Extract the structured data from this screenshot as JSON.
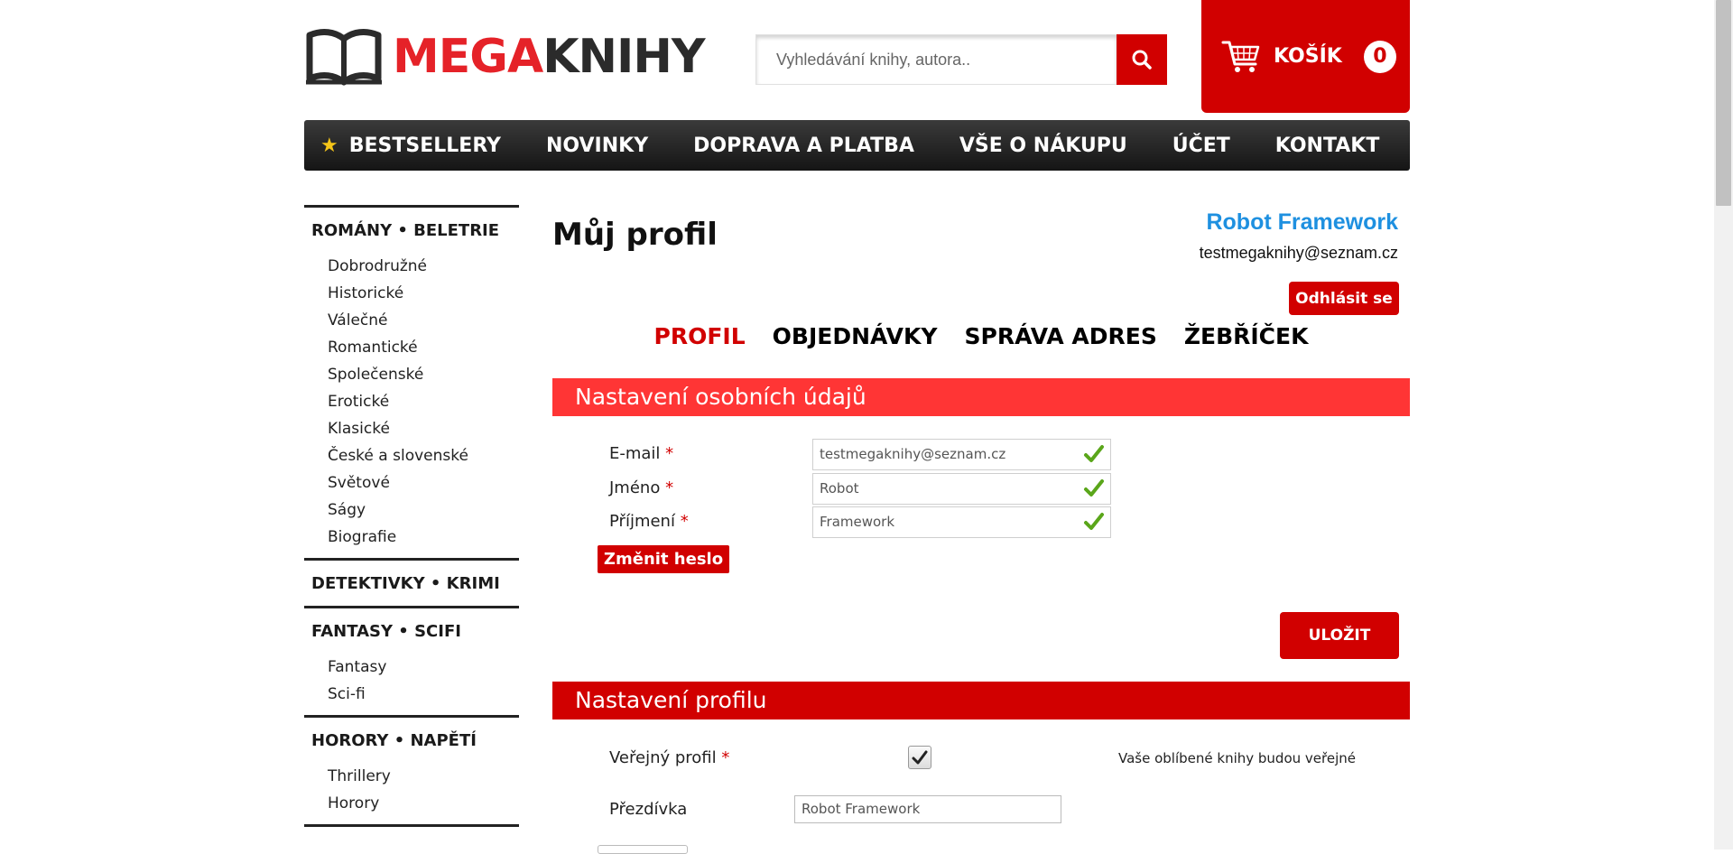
{
  "header": {
    "logo_text_mega": "MEGA",
    "logo_text_knihy": "KNIHY",
    "search_placeholder": "Vyhledávání knihy, autora..",
    "cart_label": "KOŠÍK",
    "cart_count": "0"
  },
  "nav": {
    "items": [
      "BESTSELLERY",
      "NOVINKY",
      "DOPRAVA A PLATBA",
      "VŠE O NÁKUPU",
      "ÚČET",
      "KONTAKT"
    ]
  },
  "sidebar": {
    "categories": [
      {
        "title": "ROMÁNY • BELETRIE",
        "items": [
          "Dobrodružné",
          "Historické",
          "Válečné",
          "Romantické",
          "Společenské",
          "Erotické",
          "Klasické",
          "České a slovenské",
          "Světové",
          "Ságy",
          "Biografie"
        ]
      },
      {
        "title": "DETEKTIVKY • KRIMI",
        "items": []
      },
      {
        "title": "FANTASY • SCIFI",
        "items": [
          "Fantasy",
          "Sci-fi"
        ]
      },
      {
        "title": "HORORY • NAPĚTÍ",
        "items": [
          "Thrillery",
          "Horory"
        ]
      }
    ]
  },
  "profile": {
    "page_title": "Můj profil",
    "user_name": "Robot Framework",
    "user_email": "testmegaknihy@seznam.cz",
    "logout_label": "Odhlásit se",
    "tabs": [
      "PROFIL",
      "OBJEDNÁVKY",
      "SPRÁVA ADRES",
      "ŽEBŘÍČEK"
    ],
    "active_tab": "PROFIL"
  },
  "personal_section": {
    "header": "Nastavení osobních údajů",
    "fields": [
      {
        "label": "E-mail",
        "required": "*",
        "value": "testmegaknihy@seznam.cz"
      },
      {
        "label": "Jméno",
        "required": "*",
        "value": "Robot"
      },
      {
        "label": "Příjmení",
        "required": "*",
        "value": "Framework"
      }
    ],
    "change_password_label": "Změnit heslo",
    "save_label": "ULOŽIT"
  },
  "profile_section": {
    "header": "Nastavení profilu",
    "public_label": "Veřejný profil",
    "public_required": "*",
    "public_checked": true,
    "public_note": "Vaše oblíbené knihy budou veřejné",
    "nickname_label": "Přezdívka",
    "nickname_value": "Robot Framework"
  },
  "colors": {
    "brand_red": "#d10000",
    "section_header_light": "#ff3535",
    "user_name_blue": "#1e90e0",
    "check_green": "#5aa61a"
  },
  "icons": {
    "logo": "open-book-icon",
    "search": "search-icon",
    "cart": "cart-icon",
    "bestseller": "star-icon",
    "valid": "check-icon"
  }
}
